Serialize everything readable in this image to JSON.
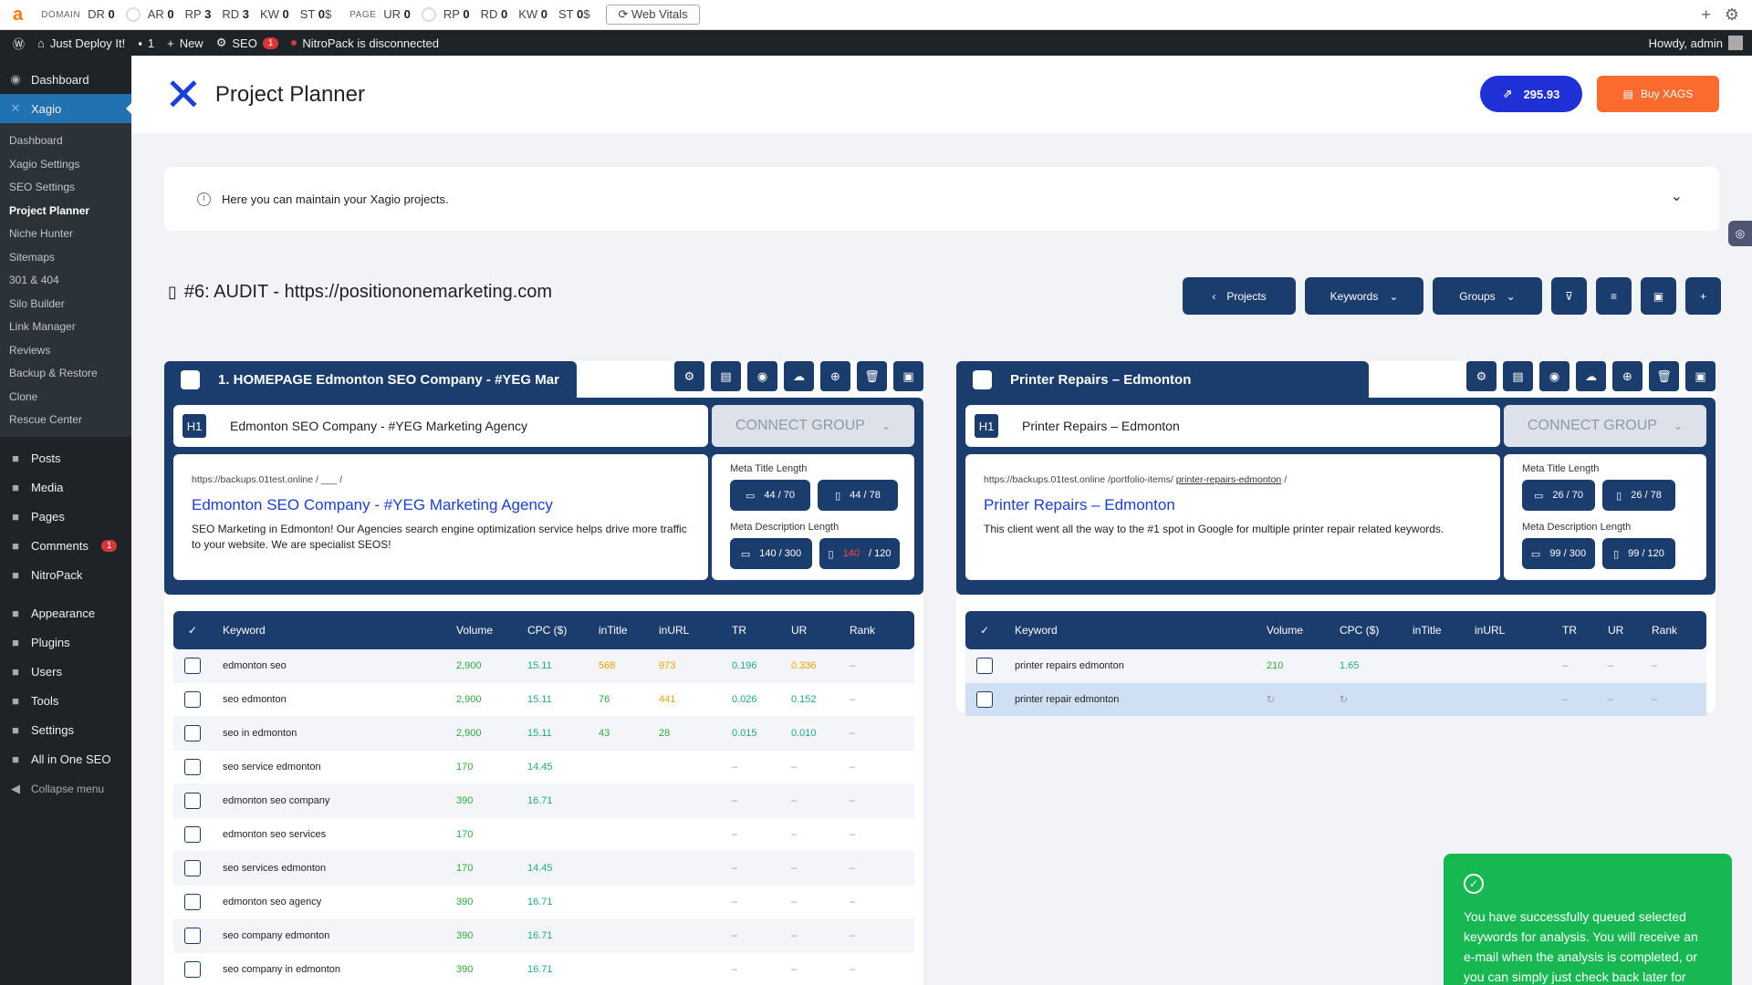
{
  "ahrefs": {
    "logo": "a",
    "domain_label": "DOMAIN",
    "page_label": "PAGE",
    "domain": [
      {
        "k": "DR",
        "v": "0"
      },
      {
        "k": "AR",
        "v": "0"
      },
      {
        "k": "RP",
        "v": "3"
      },
      {
        "k": "RD",
        "v": "3"
      },
      {
        "k": "KW",
        "v": "0"
      },
      {
        "k": "ST",
        "v": "0"
      }
    ],
    "domain_st_unit": "$",
    "page": [
      {
        "k": "UR",
        "v": "0"
      },
      {
        "k": "RP",
        "v": "0"
      },
      {
        "k": "RD",
        "v": "0"
      },
      {
        "k": "KW",
        "v": "0"
      },
      {
        "k": "ST",
        "v": "0"
      }
    ],
    "page_st_unit": "$",
    "web_vitals": "Web Vitals"
  },
  "wpbar": {
    "site": "Just Deploy It!",
    "comments": "1",
    "new": "New",
    "seo": "SEO",
    "seo_badge": "1",
    "nitro": "NitroPack is disconnected",
    "howdy": "Howdy, admin"
  },
  "sidebar": {
    "dashboard": "Dashboard",
    "xagio": "Xagio",
    "sub": [
      "Dashboard",
      "Xagio Settings",
      "SEO Settings",
      "Project Planner",
      "Niche Hunter",
      "Sitemaps",
      "301 & 404",
      "Silo Builder",
      "Link Manager",
      "Reviews",
      "Backup & Restore",
      "Clone",
      "Rescue Center"
    ],
    "items": [
      {
        "label": "Posts",
        "icon": "pin-icon"
      },
      {
        "label": "Media",
        "icon": "media-icon"
      },
      {
        "label": "Pages",
        "icon": "pages-icon"
      },
      {
        "label": "Comments",
        "icon": "comment-icon",
        "badge": "1"
      },
      {
        "label": "NitroPack",
        "icon": "nitro-icon"
      }
    ],
    "items2": [
      {
        "label": "Appearance",
        "icon": "brush-icon"
      },
      {
        "label": "Plugins",
        "icon": "plugin-icon"
      },
      {
        "label": "Users",
        "icon": "user-icon"
      },
      {
        "label": "Tools",
        "icon": "wrench-icon"
      },
      {
        "label": "Settings",
        "icon": "settings-icon"
      },
      {
        "label": "All in One SEO",
        "icon": "aioseo-icon"
      }
    ],
    "collapse": "Collapse menu"
  },
  "header": {
    "title": "Project Planner",
    "credits": "295.93",
    "buy": "Buy XAGS"
  },
  "info": "Here you can maintain your Xagio projects.",
  "project_title": "#6: AUDIT - https://positiononemarketing.com",
  "toolbar": {
    "projects": "Projects",
    "keywords": "Keywords",
    "groups": "Groups"
  },
  "groups": [
    {
      "name": "1. HOMEPAGE Edmonton SEO Company - #YEG Mar",
      "h1": "Edmonton SEO Company - #YEG Marketing Agency",
      "connect": "CONNECT GROUP",
      "url_base": "https://backups.01test.online",
      "url_path": "/ ___ /",
      "url_slug": "",
      "preview_title": "Edmonton SEO Company - #YEG Marketing Agency",
      "preview_desc": "SEO Marketing in Edmonton! Our Agencies search engine optimization service helps drive more traffic to your website. We are specialist SEOS!",
      "meta_title_label": "Meta Title Length",
      "mt1": "44 / 70",
      "mt2": "44 / 78",
      "meta_desc_label": "Meta Description Length",
      "md1": "140 / 300",
      "md2": "140",
      "md2b": " / 120",
      "headers": [
        "Keyword",
        "Volume",
        "CPC ($)",
        "inTitle",
        "inURL",
        "TR",
        "UR",
        "Rank"
      ],
      "rows": [
        {
          "kw": "edmonton seo",
          "vol": "2,900",
          "cpc": "15.11",
          "it": "568",
          "iu": "973",
          "tr": "0.196",
          "ur": "0.336",
          "rank": "–"
        },
        {
          "kw": "seo edmonton",
          "vol": "2,900",
          "cpc": "15.11",
          "it": "76",
          "iu": "441",
          "tr": "0.026",
          "ur": "0.152",
          "rank": "–"
        },
        {
          "kw": "seo in edmonton",
          "vol": "2,900",
          "cpc": "15.11",
          "it": "43",
          "iu": "28",
          "tr": "0.015",
          "ur": "0.010",
          "rank": "–"
        },
        {
          "kw": "seo service edmonton",
          "vol": "170",
          "cpc": "14.45",
          "it": "",
          "iu": "",
          "tr": "–",
          "ur": "–",
          "rank": "–"
        },
        {
          "kw": "edmonton seo company",
          "vol": "390",
          "cpc": "16.71",
          "it": "",
          "iu": "",
          "tr": "–",
          "ur": "–",
          "rank": "–"
        },
        {
          "kw": "edmonton seo services",
          "vol": "170",
          "cpc": "",
          "it": "",
          "iu": "",
          "tr": "–",
          "ur": "–",
          "rank": "–"
        },
        {
          "kw": "seo services edmonton",
          "vol": "170",
          "cpc": "14.45",
          "it": "",
          "iu": "",
          "tr": "–",
          "ur": "–",
          "rank": "–"
        },
        {
          "kw": "edmonton seo agency",
          "vol": "390",
          "cpc": "16.71",
          "it": "",
          "iu": "",
          "tr": "–",
          "ur": "–",
          "rank": "–"
        },
        {
          "kw": "seo company edmonton",
          "vol": "390",
          "cpc": "16.71",
          "it": "",
          "iu": "",
          "tr": "–",
          "ur": "–",
          "rank": "–"
        },
        {
          "kw": "seo company in edmonton",
          "vol": "390",
          "cpc": "16.71",
          "it": "",
          "iu": "",
          "tr": "–",
          "ur": "–",
          "rank": "–"
        }
      ]
    },
    {
      "name": "Printer Repairs – Edmonton",
      "h1": "Printer Repairs – Edmonton",
      "connect": "CONNECT GROUP",
      "url_base": "https://backups.01test.online",
      "url_path": "/portfolio-items/",
      "url_slug": "printer-repairs-edmonton",
      "url_end": "/",
      "preview_title": "Printer Repairs – Edmonton",
      "preview_desc": "This client went all the way to the #1 spot in Google for multiple printer repair related keywords.",
      "meta_title_label": "Meta Title Length",
      "mt1": "26 / 70",
      "mt2": "26 / 78",
      "meta_desc_label": "Meta Description Length",
      "md1": "99 / 300",
      "md2": "99 / 120",
      "headers": [
        "Keyword",
        "Volume",
        "CPC ($)",
        "inTitle",
        "inURL",
        "TR",
        "UR",
        "Rank"
      ],
      "rows": [
        {
          "kw": "printer repairs edmonton",
          "vol": "210",
          "cpc": "1.65",
          "it": "",
          "iu": "",
          "tr": "–",
          "ur": "–",
          "rank": "–"
        },
        {
          "kw": "printer repair edmonton",
          "vol": "↻",
          "cpc": "↻",
          "it": "",
          "iu": "",
          "tr": "–",
          "ur": "–",
          "rank": "–"
        }
      ]
    }
  ],
  "toast": "You have successfully queued selected keywords for analysis. You will receive an e-mail when the analysis is completed, or you can simply just check back later for results.",
  "colors": {
    "navy": "#1a3d6d",
    "brand_blue": "#1e30d6",
    "orange": "#fb6b2d",
    "green": "#17b851"
  }
}
